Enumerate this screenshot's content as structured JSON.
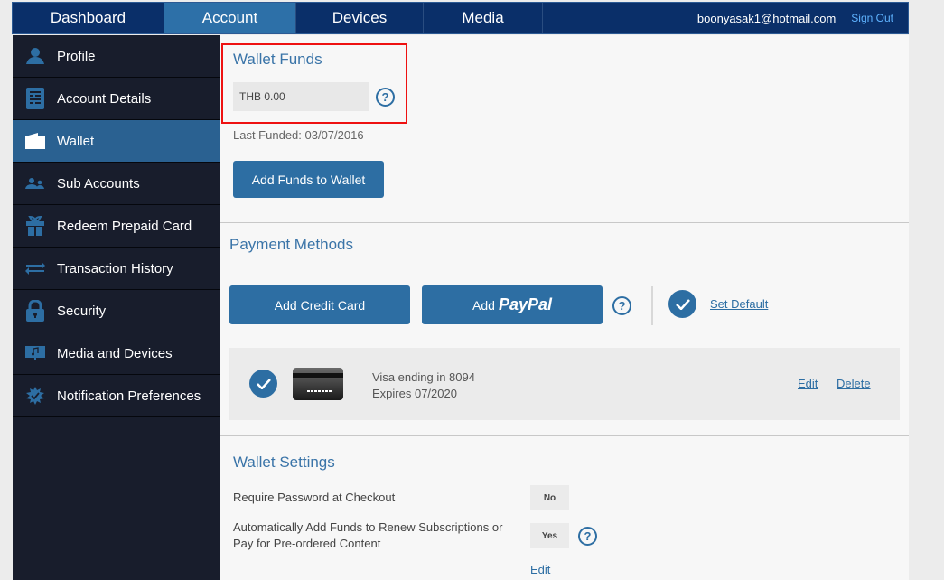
{
  "topnav": {
    "tabs": [
      {
        "label": "Dashboard",
        "active": false
      },
      {
        "label": "Account",
        "active": true
      },
      {
        "label": "Devices",
        "active": false
      },
      {
        "label": "Media",
        "active": false
      }
    ],
    "user_email": "boonyasak1@hotmail.com",
    "sign_out": "Sign Out"
  },
  "sidebar": {
    "items": [
      {
        "label": "Profile",
        "icon": "user-icon",
        "active": false
      },
      {
        "label": "Account Details",
        "icon": "document-icon",
        "active": false
      },
      {
        "label": "Wallet",
        "icon": "wallet-icon",
        "active": true
      },
      {
        "label": "Sub Accounts",
        "icon": "users-icon",
        "active": false
      },
      {
        "label": "Redeem Prepaid Card",
        "icon": "gift-icon",
        "active": false
      },
      {
        "label": "Transaction History",
        "icon": "arrows-icon",
        "active": false
      },
      {
        "label": "Security",
        "icon": "lock-icon",
        "active": false
      },
      {
        "label": "Media and Devices",
        "icon": "monitor-music-icon",
        "active": false
      },
      {
        "label": "Notification Preferences",
        "icon": "badge-check-icon",
        "active": false
      }
    ]
  },
  "wallet_funds": {
    "title": "Wallet Funds",
    "balance": "THB 0.00",
    "last_funded": "Last Funded: 03/07/2016",
    "add_funds_label": "Add Funds to Wallet"
  },
  "payment_methods": {
    "title": "Payment Methods",
    "add_credit_card_label": "Add Credit Card",
    "add_paypal_prefix": "Add",
    "add_paypal_brand": "PayPal",
    "set_default_label": "Set Default",
    "cards": [
      {
        "description": "Visa ending in 8094",
        "expires": "Expires 07/2020",
        "edit": "Edit",
        "delete": "Delete",
        "selected": true
      }
    ]
  },
  "wallet_settings": {
    "title": "Wallet Settings",
    "settings": [
      {
        "label": "Require Password at Checkout",
        "value": "No"
      },
      {
        "label_line1": "Automatically Add Funds to Renew Subscriptions or",
        "label_line2": "Pay for Pre-ordered Content",
        "value": "Yes"
      }
    ],
    "edit_label": "Edit"
  },
  "colors": {
    "nav_bg": "#0a2f69",
    "accent": "#2d6ea3",
    "sidebar_bg": "#181d2c",
    "highlight": "#ee1111"
  }
}
